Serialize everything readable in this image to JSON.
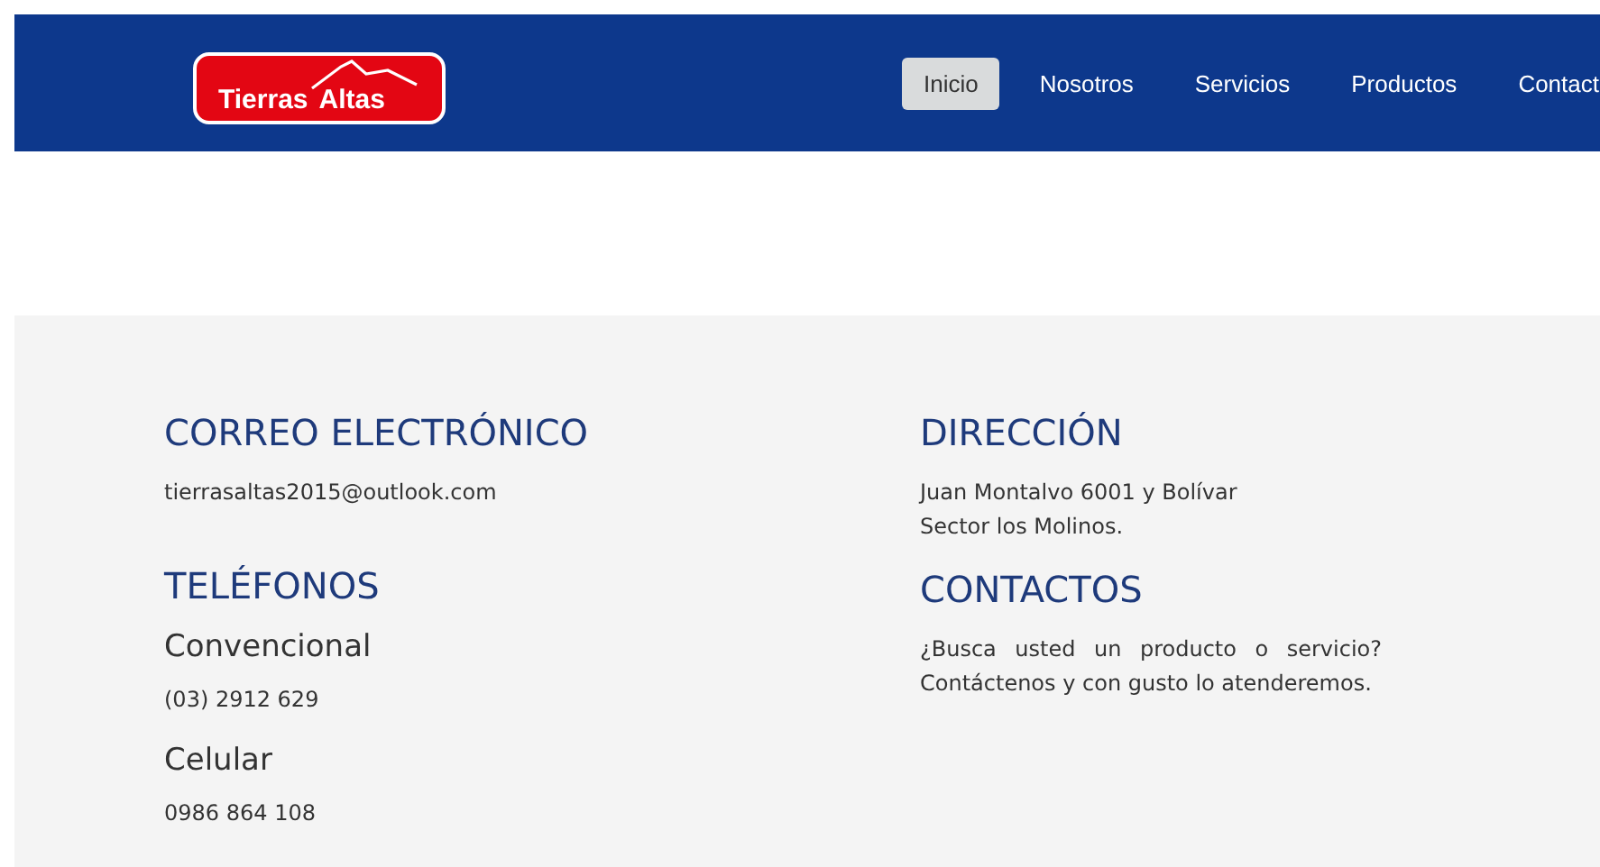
{
  "header": {
    "logo": {
      "text_1": "Tierras",
      "text_2": "Altas"
    },
    "nav": [
      {
        "label": "Inicio",
        "selected": true
      },
      {
        "label": "Nosotros",
        "selected": false
      },
      {
        "label": "Servicios",
        "selected": false
      },
      {
        "label": "Productos",
        "selected": false
      },
      {
        "label": "Contact",
        "selected": false
      }
    ]
  },
  "footer": {
    "left": [
      {
        "kind": "heading",
        "text": "CORREO ELECTRÓNICO"
      },
      {
        "kind": "text",
        "text": "tierrasaltas2015@outlook.com"
      },
      {
        "kind": "heading",
        "text": "TELÉFONOS"
      },
      {
        "kind": "subheading",
        "text": "Convencional"
      },
      {
        "kind": "text",
        "text": "(03) 2912 629"
      },
      {
        "kind": "subheading",
        "text": "Celular"
      },
      {
        "kind": "text",
        "text": "0986 864 108"
      }
    ],
    "right": [
      {
        "kind": "heading",
        "text": "DIRECCIÓN"
      },
      {
        "kind": "text",
        "text": "Juan Montalvo 6001 y Bolívar"
      },
      {
        "kind": "text",
        "text": "Sector los Molinos."
      },
      {
        "kind": "heading",
        "text": "CONTACTOS"
      },
      {
        "kind": "paragraph",
        "text": "¿Busca usted un producto o servicio? Contáctenos y con gusto lo atenderemos."
      }
    ]
  }
}
